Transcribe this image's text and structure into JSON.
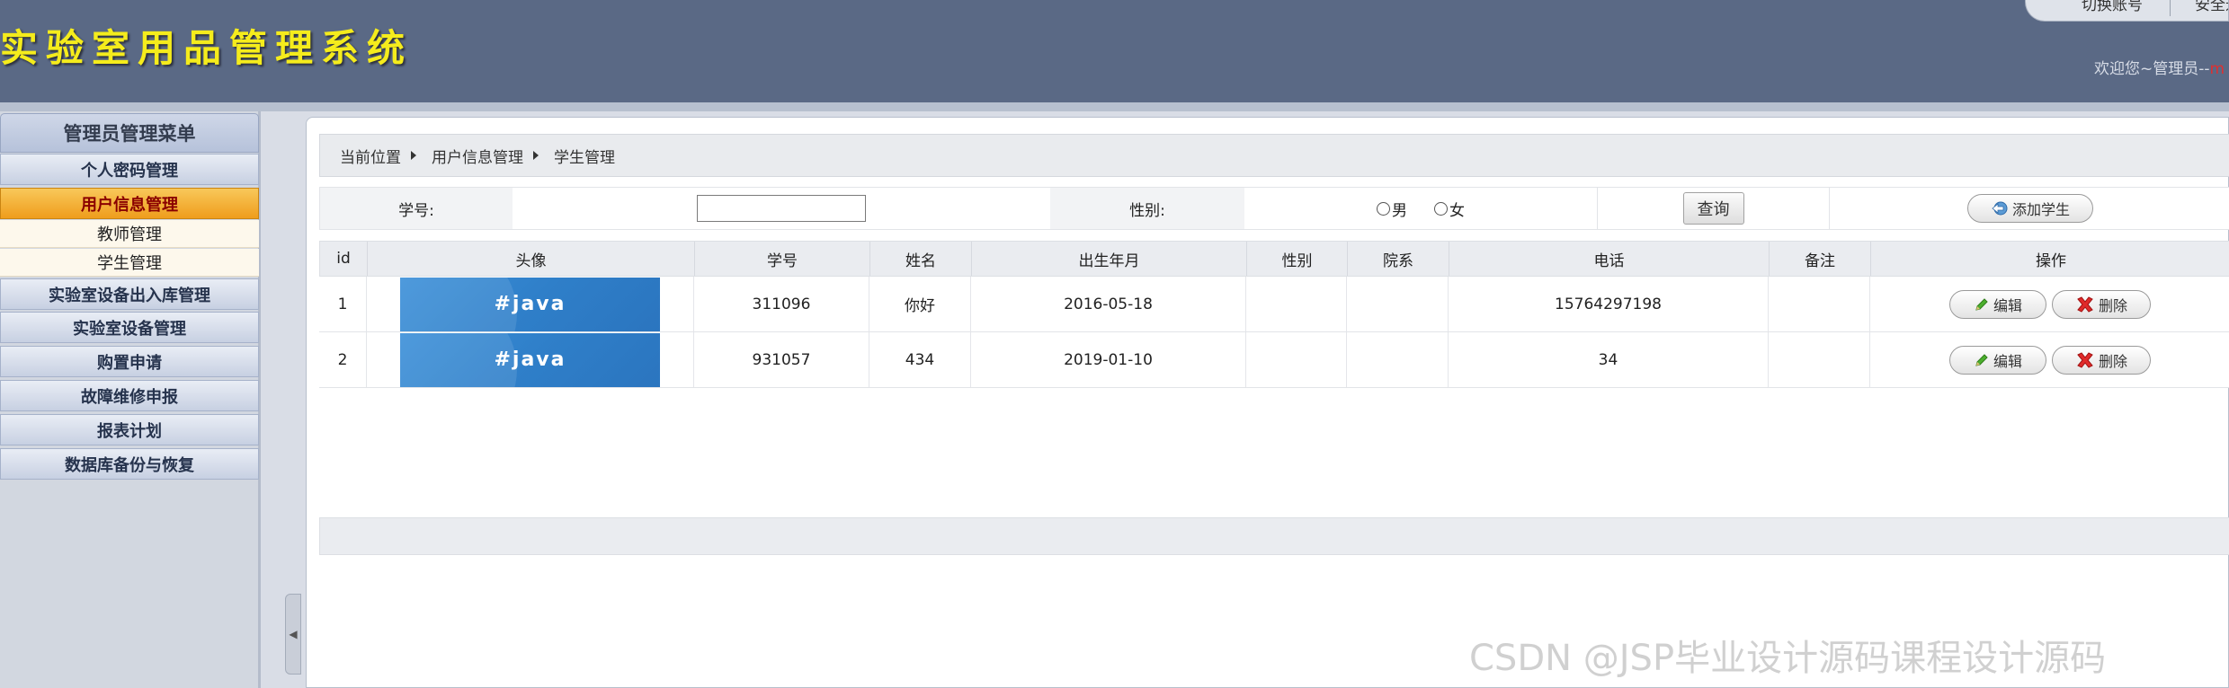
{
  "app": {
    "title": "实验室用品管理系统",
    "top_tabs": [
      "切换账号",
      "安全退出"
    ],
    "welcome": "欢迎您~管理员--",
    "welcome_user": "m"
  },
  "sidebar": {
    "title": "管理员管理菜单",
    "items": [
      {
        "label": "个人密码管理",
        "active": false
      },
      {
        "label": "用户信息管理",
        "active": true
      },
      {
        "label": "实验室设备出入库管理",
        "active": false
      },
      {
        "label": "实验室设备管理",
        "active": false
      },
      {
        "label": "购置申请",
        "active": false
      },
      {
        "label": "故障维修申报",
        "active": false
      },
      {
        "label": "报表计划",
        "active": false
      },
      {
        "label": "数据库备份与恢复",
        "active": false
      }
    ],
    "sub_items": [
      "教师管理",
      "学生管理"
    ]
  },
  "breadcrumb": [
    "当前位置",
    "用户信息管理",
    "学生管理"
  ],
  "search": {
    "student_no_label": "学号:",
    "student_no_value": "",
    "gender_label": "性别:",
    "gender_options": [
      "男",
      "女"
    ],
    "query_button": "查询",
    "add_button": "添加学生"
  },
  "table": {
    "columns": [
      "id",
      "头像",
      "学号",
      "姓名",
      "出生年月",
      "性别",
      "院系",
      "电话",
      "备注",
      "操作"
    ],
    "rows": [
      {
        "id": "1",
        "avatar": "#java",
        "student_no": "311096",
        "name": "你好",
        "birth": "2016-05-18",
        "gender": "",
        "dept": "",
        "phone": "15764297198",
        "note": ""
      },
      {
        "id": "2",
        "avatar": "#java",
        "student_no": "931057",
        "name": "434",
        "birth": "2019-01-10",
        "gender": "",
        "dept": "",
        "phone": "34",
        "note": ""
      }
    ],
    "edit_label": "编辑",
    "delete_label": "删除"
  },
  "watermark": "CSDN @JSP毕业设计源码课程设计源码"
}
